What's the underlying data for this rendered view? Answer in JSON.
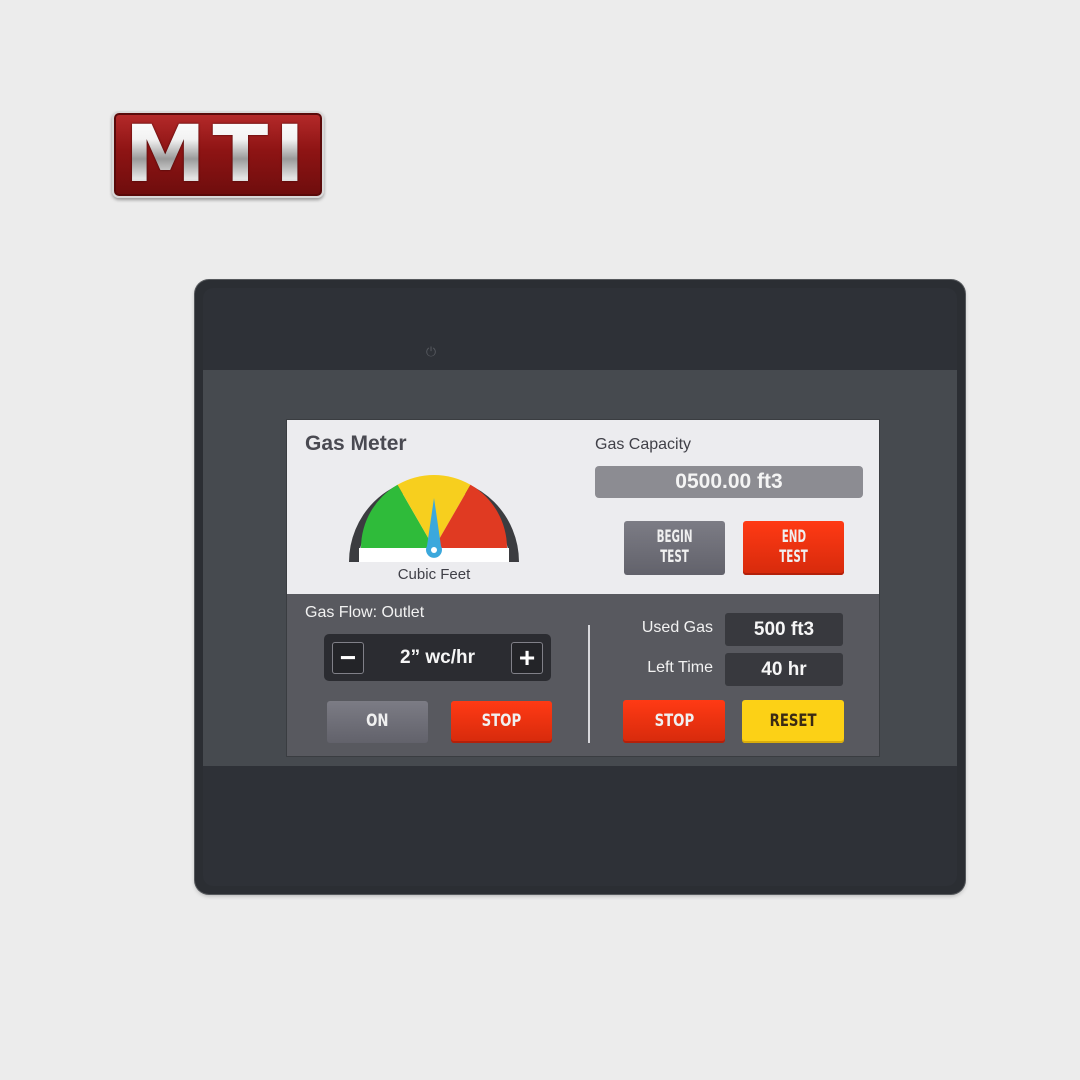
{
  "brand": {
    "logo_text": "MTI"
  },
  "device": {
    "power_icon": "power-icon"
  },
  "screen": {
    "title": "Gas Meter",
    "gauge": {
      "label": "Cubic Feet",
      "zones": [
        {
          "name": "low",
          "color": "#2fbb3a"
        },
        {
          "name": "mid",
          "color": "#f7cf1e"
        },
        {
          "name": "high",
          "color": "#e03a22"
        }
      ],
      "needle_color": "#3ba8dc",
      "needle_position": 0.5
    },
    "capacity": {
      "label": "Gas Capacity",
      "value": "0500.00 ft3"
    },
    "test_buttons": {
      "begin_line1": "BEGIN",
      "begin_line2": "TEST",
      "end_line1": "END",
      "end_line2": "TEST"
    },
    "flow": {
      "label": "Gas Flow: Outlet",
      "minus": "−",
      "plus": "+",
      "value": "2” wc/hr",
      "on_label": "ON",
      "stop_label": "STOP"
    },
    "stats": {
      "used_label": "Used Gas",
      "used_value": "500 ft3",
      "left_label": "Left Time",
      "left_value": "40 hr",
      "stop_label": "STOP",
      "reset_label": "RESET"
    }
  },
  "colors": {
    "red_button": "#f0320f",
    "yellow_button": "#fcd116",
    "gray_button": "#70707a",
    "logo_red": "#8e1414"
  }
}
